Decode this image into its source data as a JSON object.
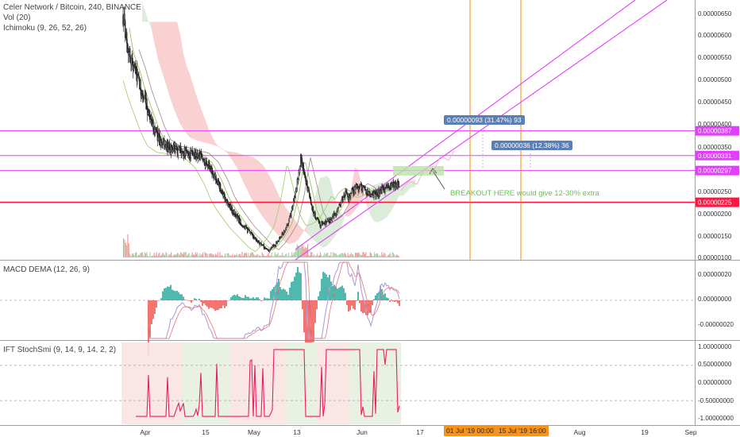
{
  "chart_data": [
    {
      "type": "candlestick",
      "title": "Celer Network / Bitcoin, 240, BINANCE",
      "indicators": [
        "Vol (20)",
        "Ichimoku (9, 26, 52, 26)"
      ],
      "x_ticks": [
        "Apr",
        "15",
        "May",
        "13",
        "Jun",
        "17",
        "Jul",
        "15",
        "Aug",
        "19",
        "Sep"
      ],
      "y_ticks": [
        "0.00000650",
        "0.00000600",
        "0.00000550",
        "0.00000500",
        "0.00000450",
        "0.00000400",
        "0.00000350",
        "0.00000250",
        "0.00000200",
        "0.00000150",
        "0.00000100"
      ],
      "ylim": [
        1e-06,
        6.8e-06
      ],
      "price_path": {
        "x_day": [
          0,
          2,
          4,
          6,
          8,
          10,
          12,
          15,
          18,
          21,
          24,
          27,
          30,
          32,
          34,
          36,
          38,
          40,
          42,
          44,
          46,
          48,
          50,
          52,
          54,
          56,
          58,
          60,
          62,
          64,
          66,
          68,
          69,
          70,
          71,
          72,
          74,
          76,
          78,
          80,
          82,
          84,
          86,
          87
        ],
        "close": [
          6.5e-06,
          5.6e-06,
          5.2e-06,
          4.7e-06,
          4.3e-06,
          3.9e-06,
          3.6e-06,
          3.45e-06,
          3.42e-06,
          3.35e-06,
          3.3e-06,
          3.1e-06,
          2.7e-06,
          2.35e-06,
          2.1e-06,
          1.9e-06,
          1.7e-06,
          1.55e-06,
          1.4e-06,
          1.25e-06,
          1.15e-06,
          1.3e-06,
          1.5e-06,
          1.75e-06,
          2.35e-06,
          3.2e-06,
          2.6e-06,
          2e-06,
          1.75e-06,
          1.8e-06,
          1.9e-06,
          2.15e-06,
          2.3e-06,
          2.45e-06,
          2.35e-06,
          2.5e-06,
          2.62e-06,
          2.55e-06,
          2.4e-06,
          2.45e-06,
          2.55e-06,
          2.6e-06,
          2.65e-06,
          2.62e-06
        ]
      },
      "horizontal_levels": [
        {
          "value": 3.87e-06,
          "label": "0.00000387",
          "color": "#e040fb"
        },
        {
          "value": 3.31e-06,
          "label": "0.00000331",
          "color": "#e040fb"
        },
        {
          "value": 2.97e-06,
          "label": "0.00000297",
          "color": "#e040fb"
        },
        {
          "value": 2.25e-06,
          "label": "0.00000225",
          "color": "#ff1744"
        }
      ],
      "measurements": [
        {
          "text": "0.00000093 (31.47%) 93"
        },
        {
          "text": "0.00000036 (12.38%) 36"
        }
      ],
      "annotation": "BREAKOUT HERE would give 12-30% extra"
    },
    {
      "type": "line",
      "title": "MACD DEMA (12, 26, 9)",
      "y_ticks": [
        "0.00000020",
        "0.00000000",
        "-0.00000020"
      ],
      "ylim": [
        -3e-07,
        3e-07
      ]
    },
    {
      "type": "line",
      "title": "IFT StochSmi (9, 14, 9, 14, 2, 2)",
      "y_ticks": [
        "1.00000000",
        "0.50000000",
        "0.00000000",
        "-0.50000000",
        "-1.00000000"
      ],
      "ylim": [
        -1.15,
        1.15
      ]
    }
  ],
  "date_labels": [
    "01 Jul '19   00:00",
    "15 Jul '19   16:00"
  ],
  "colors": {
    "up": "#26a69a",
    "down": "#ef5350",
    "candle": "#1a1a1a",
    "cloud_red": "#f8c9c9",
    "cloud_green": "#d5ead3",
    "channel": "#e040fb",
    "red_level": "#ff1744",
    "vertical": "#f7931a",
    "macd": "#b39ddb",
    "signal": "#e57373",
    "stoch_pink": "#e91e63",
    "stoch_blue": "#2196f3"
  }
}
